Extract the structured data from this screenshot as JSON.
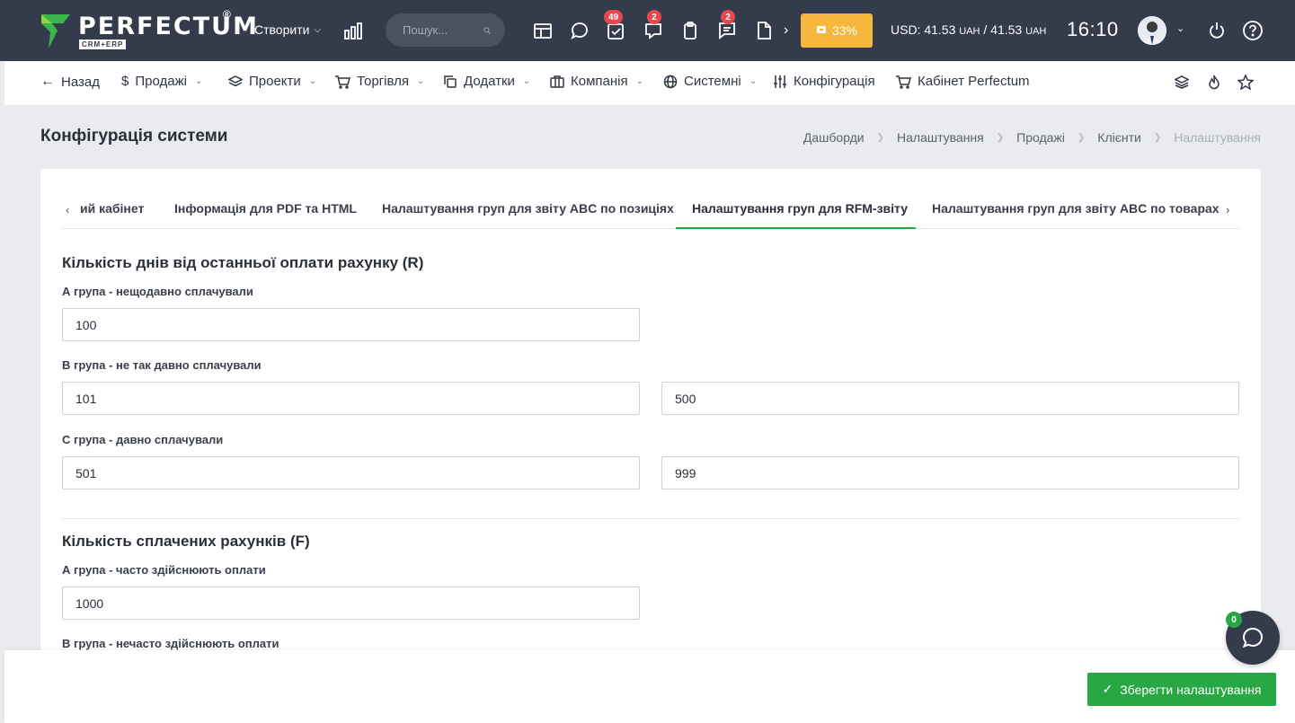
{
  "header": {
    "logo_text": "PERFECTUM",
    "logo_reg": "®",
    "logo_sub": "CRM+ERP",
    "create_label": "Створити",
    "search_placeholder": "Пошук...",
    "badges": {
      "tasks": "49",
      "messages": "2",
      "comments": "2"
    },
    "progress_label": "33%",
    "progress_value": 0.33,
    "currency_prefix": "USD: 41.53 ",
    "currency_unit1": "UAH",
    "currency_mid": " / 41.53 ",
    "currency_unit2": "UAH",
    "time": "16:10",
    "accent_color": "#f6b73c",
    "bar_color": "#343c4b"
  },
  "nav": {
    "back": "Назад",
    "sales": "Продажі",
    "projects": "Проекти",
    "trade": "Торгівля",
    "addons": "Додатки",
    "company": "Компанія",
    "system": "Системні",
    "config": "Конфігурація",
    "cabinet": "Кабінет Perfectum"
  },
  "page": {
    "title": "Конфігурація системи",
    "breadcrumbs": [
      "Дашборди",
      "Налаштування",
      "Продажі",
      "Клієнти",
      "Налаштування"
    ]
  },
  "tabs": [
    {
      "label": "ий кабінет"
    },
    {
      "label": "Інформація для PDF та HTML"
    },
    {
      "label": "Налаштування груп для звіту ABC по позиціях"
    },
    {
      "label": "Налаштування груп для RFM-звіту",
      "active": true
    },
    {
      "label": "Налаштування груп для звіту ABC по товарах"
    }
  ],
  "recency": {
    "title": "Кількість днів від останньої оплати рахунку (R)",
    "group_a": {
      "label": "А група - нещодавно сплачували",
      "value": "100"
    },
    "group_b": {
      "label": "В група - не так давно сплачували",
      "from": "101",
      "to": "500"
    },
    "group_c": {
      "label": "С група - давно сплачували",
      "from": "501",
      "to": "999"
    }
  },
  "frequency": {
    "title": "Кількість сплачених рахунків (F)",
    "group_a": {
      "label": "А група - часто здійснюють оплати",
      "value": "1000"
    },
    "group_b": {
      "label": "В група - нечасто здійснюють оплати"
    }
  },
  "footer": {
    "save_label": "Зберегти налаштування",
    "chat_badge": "0",
    "save_color": "#28a745"
  }
}
